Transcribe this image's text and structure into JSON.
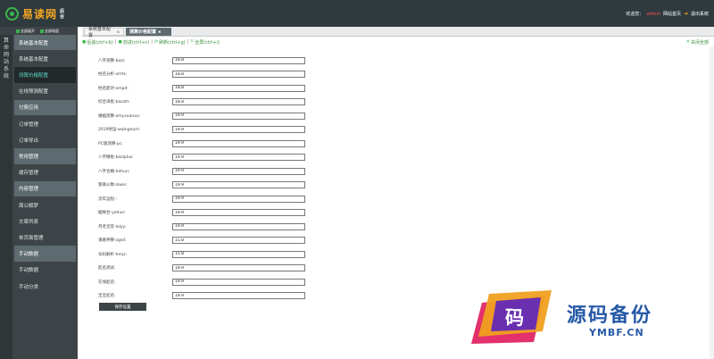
{
  "header": {
    "logo_text": "易读网",
    "logo_tag": "后台",
    "welcome": "欢迎您：",
    "user": "admin",
    "site_home": "网站首页",
    "logout": "退出系统",
    "colors": {
      "bar": "#2e3a3d",
      "logo": "#f5a623",
      "user": "#ff4d4d"
    }
  },
  "sidebar": {
    "expand_all": "全部展开",
    "collapse_all": "全部收起",
    "vertical_title": "算命网站系统",
    "items": [
      {
        "label": "系统基本配置",
        "type": "group"
      },
      {
        "label": "系统基本配置",
        "type": "sub"
      },
      {
        "label": "测算价格配置",
        "type": "active"
      },
      {
        "label": "在线预测配置",
        "type": "sub"
      },
      {
        "label": "付费应用",
        "type": "group"
      },
      {
        "label": "订单管理",
        "type": "sub"
      },
      {
        "label": "订单导出",
        "type": "sub"
      },
      {
        "label": "常用管理",
        "type": "group"
      },
      {
        "label": "缓存管理",
        "type": "sub"
      },
      {
        "label": "内容管理",
        "type": "group"
      },
      {
        "label": "周公解梦",
        "type": "sub"
      },
      {
        "label": "文章列表",
        "type": "sub"
      },
      {
        "label": "单页面管理",
        "type": "sub"
      },
      {
        "label": "手动数据",
        "type": "group"
      },
      {
        "label": "手动数据",
        "type": "sub"
      },
      {
        "label": "手动分类",
        "type": "sub"
      }
    ]
  },
  "tabs": [
    {
      "label": "系统基本配置"
    },
    {
      "label": "测算价格配置"
    }
  ],
  "toolbar": {
    "back": "后退(ctrl+b)",
    "forward": "前进(ctrl+n)",
    "refresh": "刷新(ctrl+g)",
    "fullscreen": "全屏(ctrl+i)",
    "close_all": "关闭全部"
  },
  "form": {
    "fields": [
      {
        "label": "八字测算-bazi:",
        "value": "18.8"
      },
      {
        "label": "姓名分析-xmfx:",
        "value": "18.8"
      },
      {
        "label": "姓名配对-xmpd:",
        "value": "18.8"
      },
      {
        "label": "综合详批-bazizh:",
        "value": "18.8"
      },
      {
        "label": "婚姻测算-xmysuanxu:",
        "value": "19.9"
      },
      {
        "label": "2019财运-wqingnum:",
        "value": "19.9"
      },
      {
        "label": "PC版测算-pc:",
        "value": "19.9"
      },
      {
        "label": "八字精批-baziplus:",
        "value": "19.9"
      },
      {
        "label": "八字合婚-hehun:",
        "value": "19.9"
      },
      {
        "label": "紫微斗数-ziwei:",
        "value": "19.9"
      },
      {
        "label": "流年运程-:",
        "value": "19.9"
      },
      {
        "label": "姻缘合-yehun:",
        "value": "19.9"
      },
      {
        "label": "月老灵签-lalyy:",
        "value": "19.9"
      },
      {
        "label": "诸葛神算-zgsd:",
        "value": "15.8"
      },
      {
        "label": "号码解析-hmjx:",
        "value": "15.8"
      },
      {
        "label": "起名测试:",
        "value": "19.9"
      },
      {
        "label": "在线起名:",
        "value": "19.9"
      },
      {
        "label": "宝宝起名:",
        "value": "19.9"
      }
    ],
    "save_label": "保存设置"
  },
  "watermark": {
    "char": "码",
    "title": "源码备份",
    "domain": "YMBF.CN"
  }
}
